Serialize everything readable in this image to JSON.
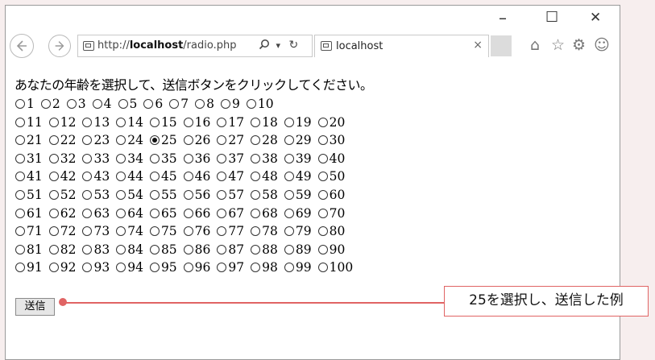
{
  "browser": {
    "window_controls": {
      "minimize": "–",
      "maximize": "☐",
      "close": "✕"
    },
    "address": {
      "prefix": "http://",
      "host": "localhost",
      "path": "/radio.php",
      "search_icon": "search-icon",
      "dropdown": "▾",
      "refresh": "↻"
    },
    "tab": {
      "title": "localhost",
      "close": "×"
    },
    "toolbar_icons": [
      "home-icon",
      "star-icon",
      "gear-icon",
      "smiley-icon"
    ]
  },
  "page": {
    "instruction": "あなたの年齢を選択して、送信ボタンをクリックしてください。",
    "ages": [
      "1",
      "2",
      "3",
      "4",
      "5",
      "6",
      "7",
      "8",
      "9",
      "10",
      "11",
      "12",
      "13",
      "14",
      "15",
      "16",
      "17",
      "18",
      "19",
      "20",
      "21",
      "22",
      "23",
      "24",
      "25",
      "26",
      "27",
      "28",
      "29",
      "30",
      "31",
      "32",
      "33",
      "34",
      "35",
      "36",
      "37",
      "38",
      "39",
      "40",
      "41",
      "42",
      "43",
      "44",
      "45",
      "46",
      "47",
      "48",
      "49",
      "50",
      "51",
      "52",
      "53",
      "54",
      "55",
      "56",
      "57",
      "58",
      "59",
      "60",
      "61",
      "62",
      "63",
      "64",
      "65",
      "66",
      "67",
      "68",
      "69",
      "70",
      "71",
      "72",
      "73",
      "74",
      "75",
      "76",
      "77",
      "78",
      "79",
      "80",
      "81",
      "82",
      "83",
      "84",
      "85",
      "86",
      "87",
      "88",
      "89",
      "90",
      "91",
      "92",
      "93",
      "94",
      "95",
      "96",
      "97",
      "98",
      "99",
      "100"
    ],
    "selected": "25",
    "submit_label": "送信"
  },
  "annotation": {
    "text": "25を選択し、送信した例",
    "color": "#e06464"
  }
}
